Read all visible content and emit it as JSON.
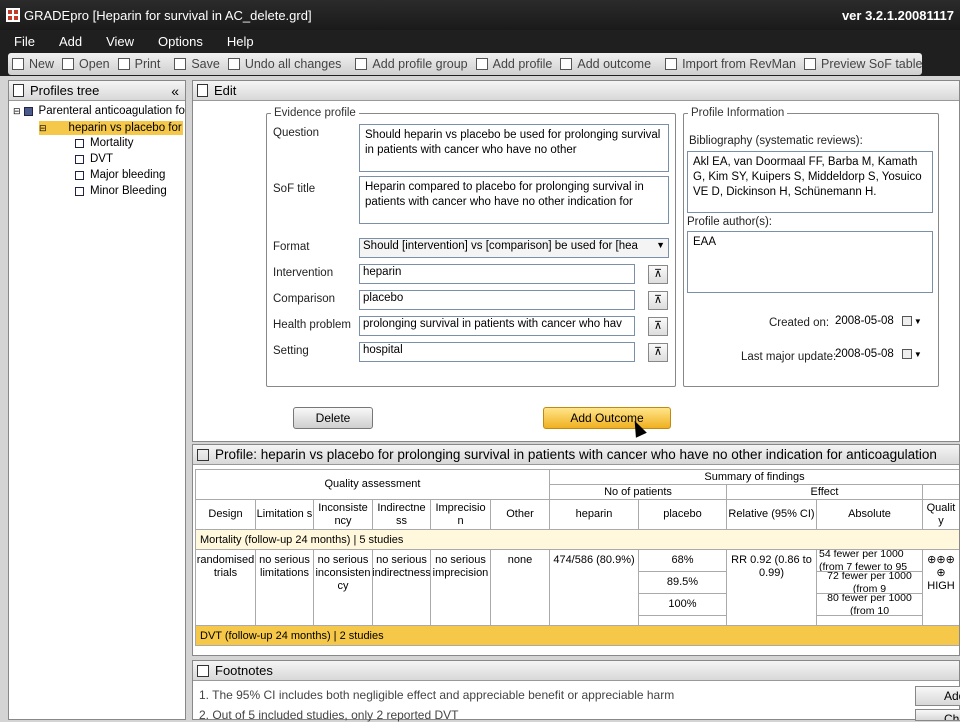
{
  "window": {
    "title": "GRADEpro [Heparin for survival in AC_delete.grd]",
    "version": "ver 3.2.1.20081117"
  },
  "menu": [
    "File",
    "Add",
    "View",
    "Options",
    "Help"
  ],
  "toolbar": {
    "new": "New",
    "open": "Open",
    "print": "Print",
    "save": "Save",
    "undo": "Undo all changes",
    "add_profile_group": "Add profile group",
    "add_profile": "Add profile",
    "add_outcome": "Add outcome",
    "import": "Import from RevMan",
    "preview": "Preview SoF table"
  },
  "profiles_tree": {
    "title": "Profiles tree",
    "collapse_glyph": "«",
    "group": "Parenteral anticoagulation fo",
    "profile": "heparin vs placebo for",
    "outcomes": [
      "Mortality",
      "DVT",
      "Major bleeding",
      "Minor Bleeding"
    ]
  },
  "edit": {
    "title": "Edit",
    "evidence_legend": "Evidence profile",
    "question_label": "Question",
    "question_value": "Should heparin vs placebo be used for prolonging survival in patients with cancer who have no other",
    "sof_label": "SoF title",
    "sof_value": "Heparin compared to placebo for prolonging survival in patients with cancer who have no other indication for",
    "format_label": "Format",
    "format_value": "Should [intervention] vs [comparison] be used for [hea",
    "intervention_label": "Intervention",
    "intervention_value": "heparin",
    "comparison_label": "Comparison",
    "comparison_value": "placebo",
    "health_label": "Health problem",
    "health_value": "prolonging survival in patients with cancer who hav",
    "setting_label": "Setting",
    "setting_value": "hospital",
    "pin_glyph": "⊼",
    "info_legend": "Profile Information",
    "biblio_label": "Bibliography (systematic reviews):",
    "biblio_value": "Akl EA, van Doormaal FF, Barba M, Kamath G, Kim SY, Kuipers S, Middeldorp S, Yosuico VE D, Dickinson H, Schünemann H.",
    "author_label": "Profile author(s):",
    "author_value": "EAA",
    "created_label": "Created on:",
    "created_value": "2008-05-08",
    "updated_label": "Last major update:",
    "updated_value": "2008-05-08",
    "delete_button": "Delete",
    "add_outcome_button": "Add Outcome"
  },
  "profile_table": {
    "title": "Profile: heparin vs placebo for prolonging survival in patients with cancer who have no other indication for anticoagulation",
    "quality_assessment": "Quality assessment",
    "summary": "Summary of findings",
    "no_patients": "No of patients",
    "effect": "Effect",
    "columns": [
      "Design",
      "Limitation s",
      "Inconsiste ncy",
      "Indirectne ss",
      "Imprecisio n",
      "Other",
      "heparin",
      "placebo",
      "Relative (95% CI)",
      "Absolute",
      "Qualit y"
    ],
    "group1": "Mortality (follow-up 24 months) | 5 studies",
    "row1": {
      "design": "randomised trials",
      "limitations": "no serious limitations",
      "inconsistency": "no serious inconsisten cy",
      "indirectness": "no serious indirectness",
      "imprecision": "no serious imprecision",
      "other": "none",
      "heparin": "474/586 (80.9%)",
      "placebo": [
        "68%",
        "89.5%",
        "100%"
      ],
      "relative": "RR 0.92 (0.86 to 0.99)",
      "absolute": [
        "54 fewer per 1000 (from 7 fewer to 95",
        "72 fewer per 1000 (from 9",
        "80 fewer per 1000 (from 10"
      ],
      "quality": "⊕⊕⊕ ⊕ HIGH"
    },
    "group2": "DVT (follow-up 24 months) | 2 studies"
  },
  "footnotes": {
    "title": "Footnotes",
    "items": [
      "1. The 95% CI includes both negligible effect and appreciable benefit or appreciable harm",
      "2. Out of 5 included studies, only 2 reported DVT"
    ],
    "add_button": "Add",
    "change_button": "Change"
  }
}
